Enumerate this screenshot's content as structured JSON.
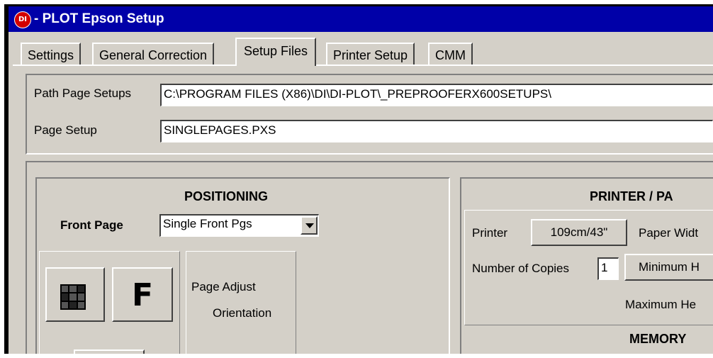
{
  "window": {
    "title": "- PLOT  Epson Setup",
    "logo_text": "DI",
    "accent_color": "#0000a8",
    "logo_color": "#d40000"
  },
  "tabs": [
    {
      "label": "Settings",
      "active": false
    },
    {
      "label": "General Correction",
      "active": false
    },
    {
      "label": "Setup Files",
      "active": true
    },
    {
      "label": "Printer Setup",
      "active": false
    },
    {
      "label": "CMM",
      "active": false
    }
  ],
  "setup_files": {
    "path_label": "Path Page Setups",
    "path_value": "C:\\PROGRAM FILES (X86)\\DI\\DI-PLOT\\_PREPROOFERX600SETUPS\\",
    "page_setup_label": "Page Setup",
    "page_setup_value": "SINGLEPAGES.PXS"
  },
  "positioning": {
    "heading": "POSITIONING",
    "front_page_label": "Front Page",
    "front_page_value": "Single Front Pgs",
    "grid_icon": "grid-icon",
    "f_button_text": "F",
    "page_adjust_label": "Page Adjust",
    "orientation_label": "Orientation"
  },
  "printer_panel": {
    "heading": "PRINTER / PA",
    "printer_label": "Printer",
    "printer_button": "109cm/43\"",
    "paper_width_label": "Paper Widt",
    "copies_label": "Number of Copies",
    "copies_value": "1",
    "min_height_button": "Minimum H",
    "max_height_label": "Maximum He",
    "memory_heading": "MEMORY"
  }
}
